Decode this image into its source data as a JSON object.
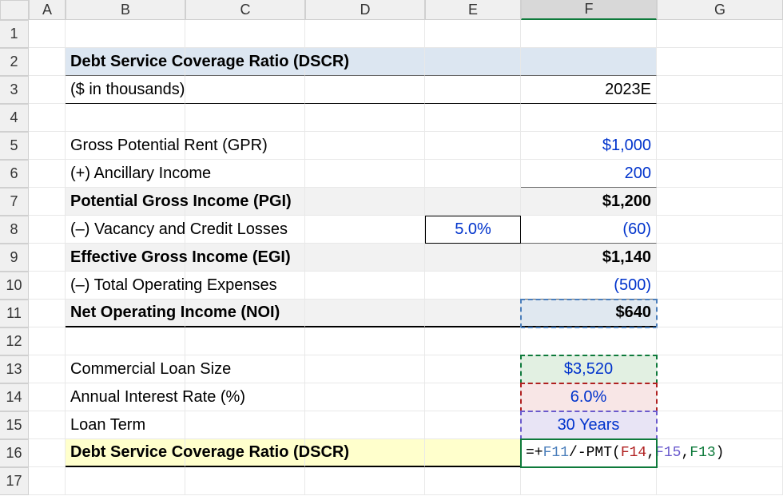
{
  "columns": [
    "A",
    "B",
    "C",
    "D",
    "E",
    "F",
    "G"
  ],
  "rows": [
    "1",
    "2",
    "3",
    "4",
    "5",
    "6",
    "7",
    "8",
    "9",
    "10",
    "11",
    "12",
    "13",
    "14",
    "15",
    "16",
    "17"
  ],
  "active_column": "F",
  "title": "Debt Service Coverage Ratio (DSCR)",
  "subtitle": "($ in thousands)",
  "year_label": "2023E",
  "r5_label": "Gross Potential Rent (GPR)",
  "r5_val": "$1,000",
  "r6_label": "(+) Ancillary Income",
  "r6_val": "200",
  "r7_label": "Potential Gross Income (PGI)",
  "r7_val": "$1,200",
  "r8_label": "(–) Vacancy and Credit Losses",
  "r8_pct": "5.0%",
  "r8_val": "(60)",
  "r9_label": "Effective Gross Income (EGI)",
  "r9_val": "$1,140",
  "r10_label": "(–) Total Operating Expenses",
  "r10_val": "(500)",
  "r11_label": "Net Operating Income (NOI)",
  "r11_val": "$640",
  "r13_label": "Commercial Loan Size",
  "r13_val": "$3,520",
  "r14_label": "Annual Interest Rate (%)",
  "r14_val": "6.0%",
  "r15_label": "Loan Term",
  "r15_val": "30 Years",
  "r16_label": "Debt Service Coverage Ratio (DSCR)",
  "formula": {
    "raw_display": "=+F11/-PMT(F14,F15,F13)",
    "pre": "=+",
    "ref1": "F11",
    "mid1": "/-PMT(",
    "ref2": "F14",
    "c1": ",",
    "ref3": "F15",
    "c2": ",",
    "ref4": "F13",
    "end": ")"
  }
}
